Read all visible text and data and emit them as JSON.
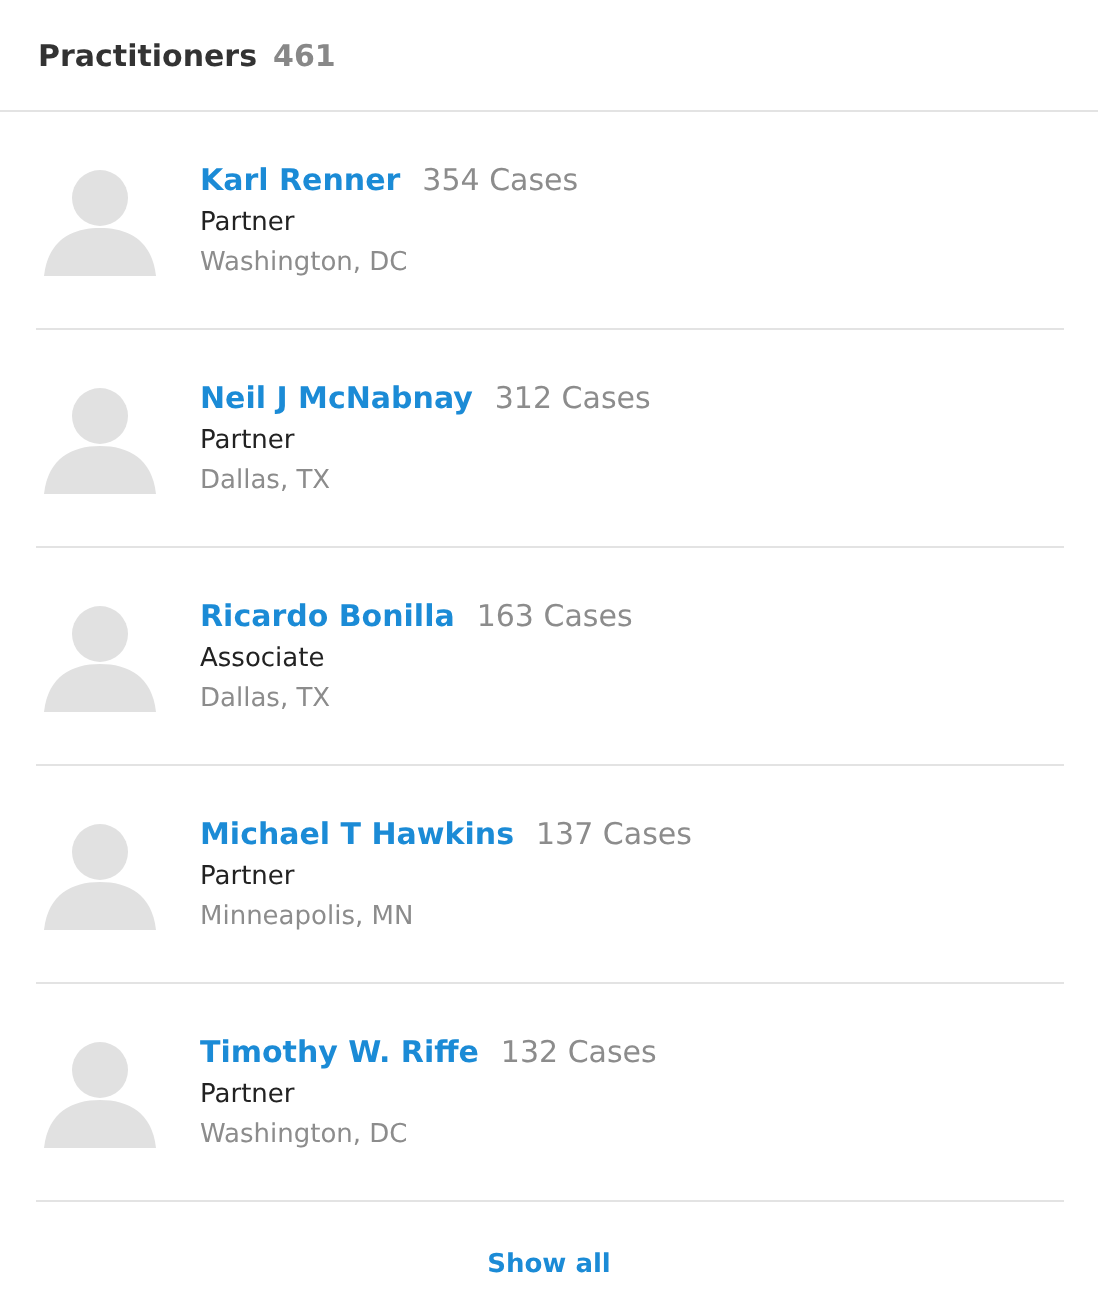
{
  "header": {
    "title": "Practitioners",
    "count": "461"
  },
  "practitioners": [
    {
      "name": "Karl Renner",
      "cases": "354 Cases",
      "role": "Partner",
      "location": "Washington, DC"
    },
    {
      "name": "Neil J McNabnay",
      "cases": "312 Cases",
      "role": "Partner",
      "location": "Dallas, TX"
    },
    {
      "name": "Ricardo Bonilla",
      "cases": "163 Cases",
      "role": "Associate",
      "location": "Dallas, TX"
    },
    {
      "name": "Michael T Hawkins",
      "cases": "137 Cases",
      "role": "Partner",
      "location": "Minneapolis, MN"
    },
    {
      "name": "Timothy W. Riffe",
      "cases": "132 Cases",
      "role": "Partner",
      "location": "Washington, DC"
    }
  ],
  "footer": {
    "link": "Show all"
  }
}
